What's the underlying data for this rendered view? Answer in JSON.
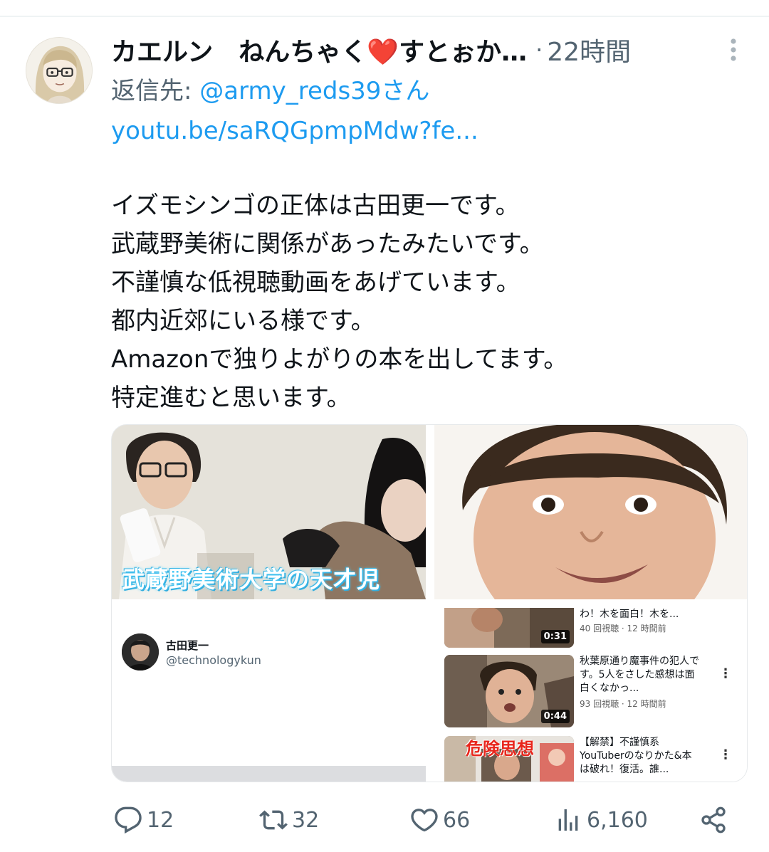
{
  "tweet": {
    "display_name": "カエルン　ねんちゃく❤️すとぉか…",
    "separator": "·",
    "time": "22時間",
    "reply_prefix": "返信先: ",
    "reply_handle": "@army_reds39さん",
    "link_text": "youtu.be/saRQGpmpMdw?fe...",
    "body_lines": [
      "イズモシンゴの正体は古田更一です。",
      "武蔵野美術に関係があったみたいです。",
      "不謹慎な低視聴動画をあげています。",
      "都内近郊にいる様です。",
      "Amazonで独りよがりの本を出してます。",
      "特定進むと思います。"
    ]
  },
  "media": {
    "tile1_caption": "武蔵野美術大学の天才児",
    "profile_card": {
      "name": "古田更一",
      "handle": "@technologykun"
    },
    "video_list": [
      {
        "title": "わ！木を面白！木を...",
        "meta": "40 回視聴 · 12 時間前",
        "duration": "0:31"
      },
      {
        "title": "秋葉原通り魔事件の犯人です。5人をさした感想は面白くなかっ...",
        "meta": "93 回視聴 · 12 時間前",
        "duration": "0:44"
      },
      {
        "title": "【解禁】不謹慎系YouTuberのなりかた&本は破れ！復活。誰...",
        "meta": "",
        "thumb_text": "危険思想"
      }
    ],
    "more_glyph": "⋮"
  },
  "actions": {
    "replies": "12",
    "retweets": "32",
    "likes": "66",
    "views": "6,160"
  },
  "icons": {
    "more": "more-vertical-icon",
    "reply": "reply-bubble-icon",
    "retweet": "retweet-icon",
    "like": "heart-icon",
    "views": "views-bar-chart-icon",
    "share": "share-icon"
  },
  "colors": {
    "link": "#1d9bf0",
    "secondary_text": "#536471",
    "primary_text": "#0f1419"
  }
}
